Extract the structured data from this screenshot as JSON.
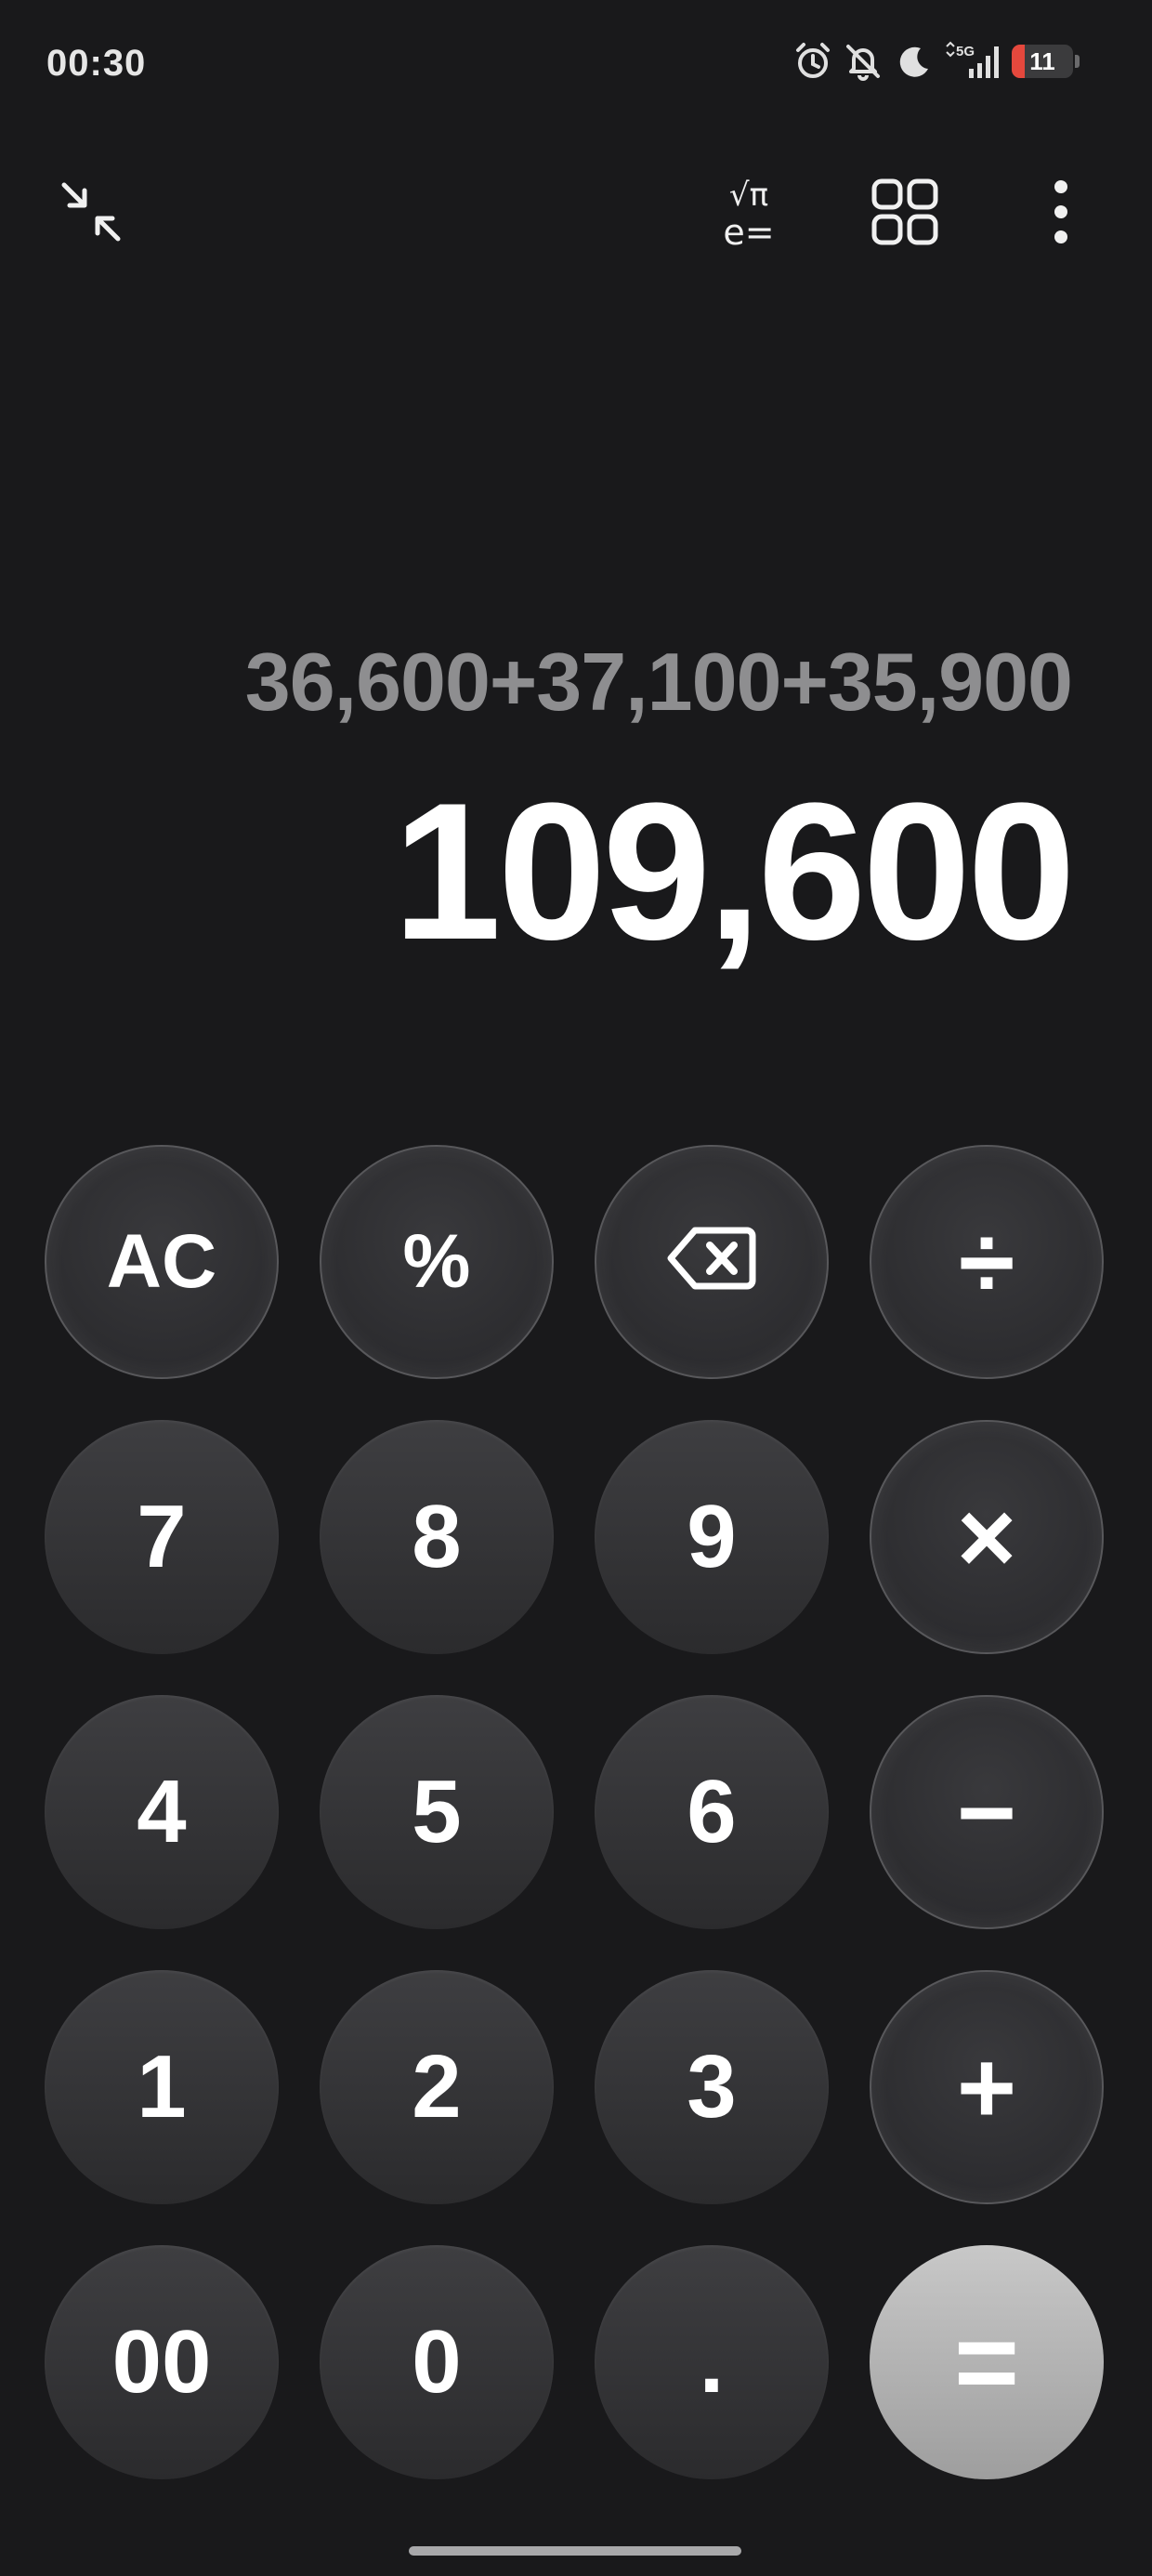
{
  "status_bar": {
    "time": "00:30",
    "network": "5G",
    "battery_level": "11",
    "battery_fraction": 0.11,
    "battery_color": "#e5483d",
    "icons": [
      "alarm-icon",
      "bell-muted-icon",
      "moon-icon",
      "signal-icon",
      "battery-icon"
    ]
  },
  "toolbar": {
    "icons": [
      "minimize-icon",
      "scientific-mode-icon",
      "apps-grid-icon",
      "more-options-icon"
    ],
    "scientific_label": [
      "√π",
      "e="
    ]
  },
  "display": {
    "expression": "36,600+37,100+35,900",
    "result": "109,600"
  },
  "keypad": {
    "row1": [
      "AC",
      "%",
      "⌫",
      "÷"
    ],
    "row2": [
      "7",
      "8",
      "9",
      "×"
    ],
    "row3": [
      "4",
      "5",
      "6",
      "−"
    ],
    "row4": [
      "1",
      "2",
      "3",
      "+"
    ],
    "row5": [
      "00",
      "0",
      ".",
      "="
    ]
  },
  "colors": {
    "background": "#19191b",
    "key": "#333336",
    "equals": "#b4b4b4",
    "expression_text": "#8e8e90"
  }
}
